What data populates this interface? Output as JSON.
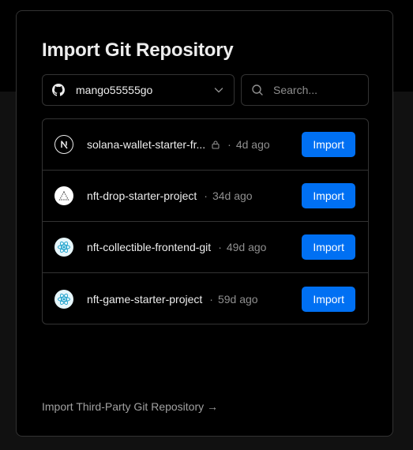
{
  "modal": {
    "title": "Import Git Repository",
    "account_select": {
      "value": "mango55555go",
      "icon": "github-icon"
    },
    "search": {
      "placeholder": "Search...",
      "value": ""
    },
    "repositories": [
      {
        "name": "solana-wallet-starter-fr...",
        "logo": "nextjs-logo-icon",
        "private": true,
        "age": "4d ago",
        "button": "Import"
      },
      {
        "name": "nft-drop-starter-project",
        "logo": "triangle-logo-icon",
        "private": false,
        "age": "34d ago",
        "button": "Import"
      },
      {
        "name": "nft-collectible-frontend-git",
        "logo": "react-logo-icon",
        "private": false,
        "age": "49d ago",
        "button": "Import"
      },
      {
        "name": "nft-game-starter-project",
        "logo": "react-logo-icon",
        "private": false,
        "age": "59d ago",
        "button": "Import"
      }
    ],
    "separator": "·",
    "third_party_link": "Import Third-Party Git Repository →"
  },
  "colors": {
    "background": "#000000",
    "border": "#333333",
    "accent": "#0070f3",
    "muted_text": "#8f8f8f"
  }
}
